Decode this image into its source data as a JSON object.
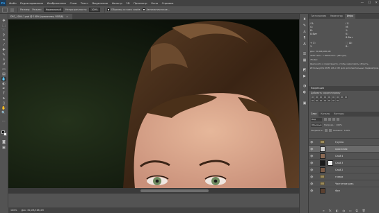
{
  "app": {
    "logo": "Ps"
  },
  "menu": [
    "Файл",
    "Редактирование",
    "Изображение",
    "Слои",
    "Текст",
    "Выделение",
    "Фильтр",
    "3D",
    "Просмотр",
    "Окно",
    "Справка"
  ],
  "window_controls": {
    "minimize": "—",
    "maximize": "☐",
    "close": "✕"
  },
  "options": {
    "size_label": "Размер:",
    "mode_label": "Режим:",
    "mode_value": "Нормальный",
    "opacity_label": "Непрозрачность:",
    "opacity_value": "100%",
    "sample_all_label": "Образец со всех слоёв",
    "auto_enhance_label": "Автоматическое..."
  },
  "document": {
    "tab_title": "DSC_1004-1.psd @ 100% (красочная, RGB/8)",
    "close": "×"
  },
  "status": {
    "zoom": "100%",
    "doc_size": "Док: 30,0М/168,4М"
  },
  "panel_tabs_top": [
    "Гистограмма",
    "Навигатор",
    "Инфо"
  ],
  "info": {
    "r_label": "R:",
    "g_label": "G:",
    "b_label": "B:",
    "c_label": "C:",
    "m_label": "M:",
    "y_label": "Y:",
    "k_label": "K:",
    "x_label": "X:",
    "y2_label": "Y:",
    "w_label": "Ш:",
    "h_label": "В:",
    "bit_left": "8-бит",
    "bit_right": "8-бит",
    "doc_line": "Док: 30,0М/168,4М",
    "size_line": "3257 пикс. x 4046 пикс. (240 ppi)",
    "ms_line": "76,8мс",
    "hint_line1": "Щелкните и перетащите, чтобы зарисовать область.",
    "hint_line2": "Используйте Shift, Alt и Ctrl для дополнительных параметров."
  },
  "corrections": {
    "title": "Коррекция",
    "subtitle": "Добавить корректировку"
  },
  "layers_tabs": [
    "Слои",
    "Каналы",
    "Контуры"
  ],
  "layers_toolbar": {
    "kind_label": "Вид",
    "blend_value": "Обычные",
    "opacity_label": "Непрозр.:",
    "opacity_value": "100%",
    "lock_label": "Закрепить:",
    "fill_label": "Заливка:",
    "fill_value": "100%"
  },
  "layers": [
    {
      "name": "Группа",
      "kind": "folder"
    },
    {
      "name": "красочная",
      "kind": "pixel",
      "selected": true
    },
    {
      "name": "Слой 4",
      "kind": "pixel"
    },
    {
      "name": "Слой 3",
      "kind": "mask"
    },
    {
      "name": "Слой 2",
      "kind": "pixel"
    },
    {
      "name": "глазки",
      "kind": "folder"
    },
    {
      "name": "Частотное разл.",
      "kind": "folder"
    },
    {
      "name": "Фон",
      "kind": "pixel"
    }
  ],
  "layer_footer": [
    "∞",
    "fx",
    "◧",
    "◑",
    "▭",
    "⧉",
    "🗑"
  ],
  "colors": {
    "accent": "#31a8ff",
    "ui_dark": "#424242",
    "ui_mid": "#535353",
    "selected_row": "#6a6a6a"
  }
}
